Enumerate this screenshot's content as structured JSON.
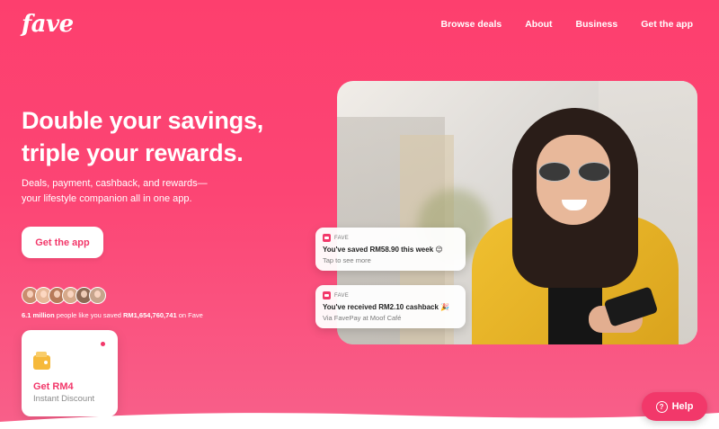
{
  "brand": {
    "logo": "fave"
  },
  "nav": [
    {
      "label": "Browse deals"
    },
    {
      "label": "About"
    },
    {
      "label": "Business"
    },
    {
      "label": "Get the app"
    }
  ],
  "hero": {
    "title_line1": "Double your savings,",
    "title_line2": "triple your rewards.",
    "subtitle_line1": "Deals, payment, cashback, and rewards—",
    "subtitle_line2": "your lifestyle companion all in one app.",
    "cta_label": "Get the app"
  },
  "social_proof": {
    "avatar_colors": [
      "#c98d6e",
      "#e6b899",
      "#b77a5a",
      "#d6a98a",
      "#8d6a55",
      "#c6a48c"
    ],
    "people_count": "6.1 million",
    "text_mid": "people like you saved",
    "amount": "RM1,654,760,741",
    "text_end": "on Fave"
  },
  "discount_card": {
    "title": "Get RM4",
    "subtitle": "Instant Discount",
    "icon": "wallet-icon"
  },
  "notifications": [
    {
      "app": "FAVE",
      "title": "You've saved RM58.90 this week 😉",
      "subtitle": "Tap to see more"
    },
    {
      "app": "FAVE",
      "title": "You've received RM2.10 cashback 🎉",
      "subtitle": "Via FavePay at Moof Café"
    }
  ],
  "help_button": {
    "label": "Help",
    "icon": "question-icon"
  },
  "colors": {
    "brand": "#f2386a",
    "bg_top": "#fd3f6e",
    "bg_bottom": "#f8608a"
  }
}
